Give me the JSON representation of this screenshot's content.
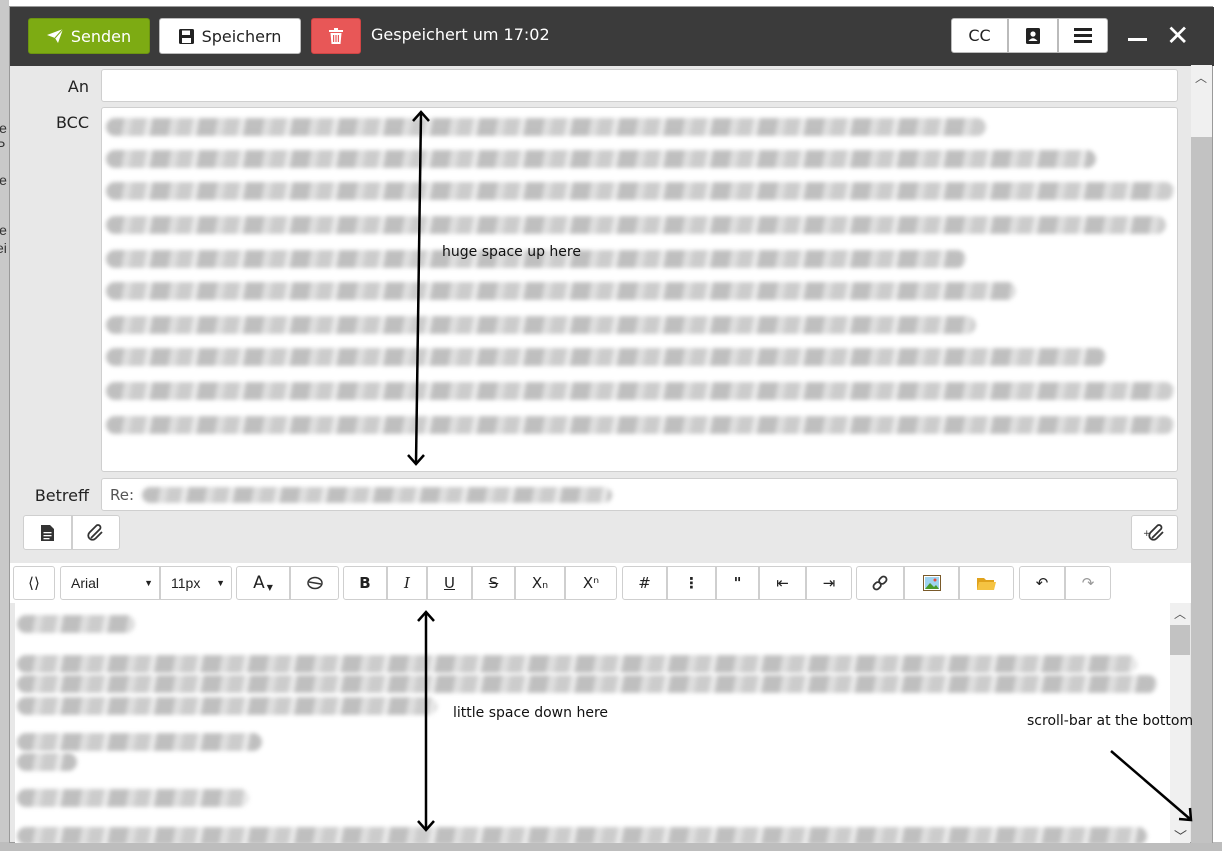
{
  "toolbar": {
    "send_label": "Senden",
    "save_label": "Speichern",
    "saved_status": "Gespeichert um 17:02",
    "cc_label": "CC"
  },
  "fields": {
    "to_label": "An",
    "to_value": "",
    "bcc_label": "BCC",
    "subject_label": "Betreff",
    "subject_prefix": "Re:"
  },
  "editor": {
    "source_label": "⟨⟩",
    "font_family": "Arial",
    "font_size": "11px",
    "font_color_label": "A",
    "bold_label": "B",
    "italic_label": "I",
    "underline_label": "U",
    "strike_label": "S",
    "subscript_label": "Xₙ",
    "superscript_label": "Xⁿ",
    "ordered_list_label": "#",
    "bullet_list_label": "⋮",
    "quote_label": "\"",
    "outdent_label": "⇤",
    "indent_label": "⇥",
    "undo_label": "↶",
    "redo_label": "↷"
  },
  "annotations": {
    "top_note": "huge space up here",
    "bottom_note": "little space down here",
    "scroll_note": "scroll-bar at the bottom"
  },
  "colors": {
    "send_green": "#7dab13",
    "delete_red": "#e85757",
    "titlebar": "#3b3b3b"
  },
  "icons": {
    "send": "paper-plane-icon",
    "save": "floppy-disk-icon",
    "delete": "trash-icon",
    "contacts": "address-book-icon",
    "menu": "hamburger-menu-icon",
    "close": "close-icon"
  }
}
